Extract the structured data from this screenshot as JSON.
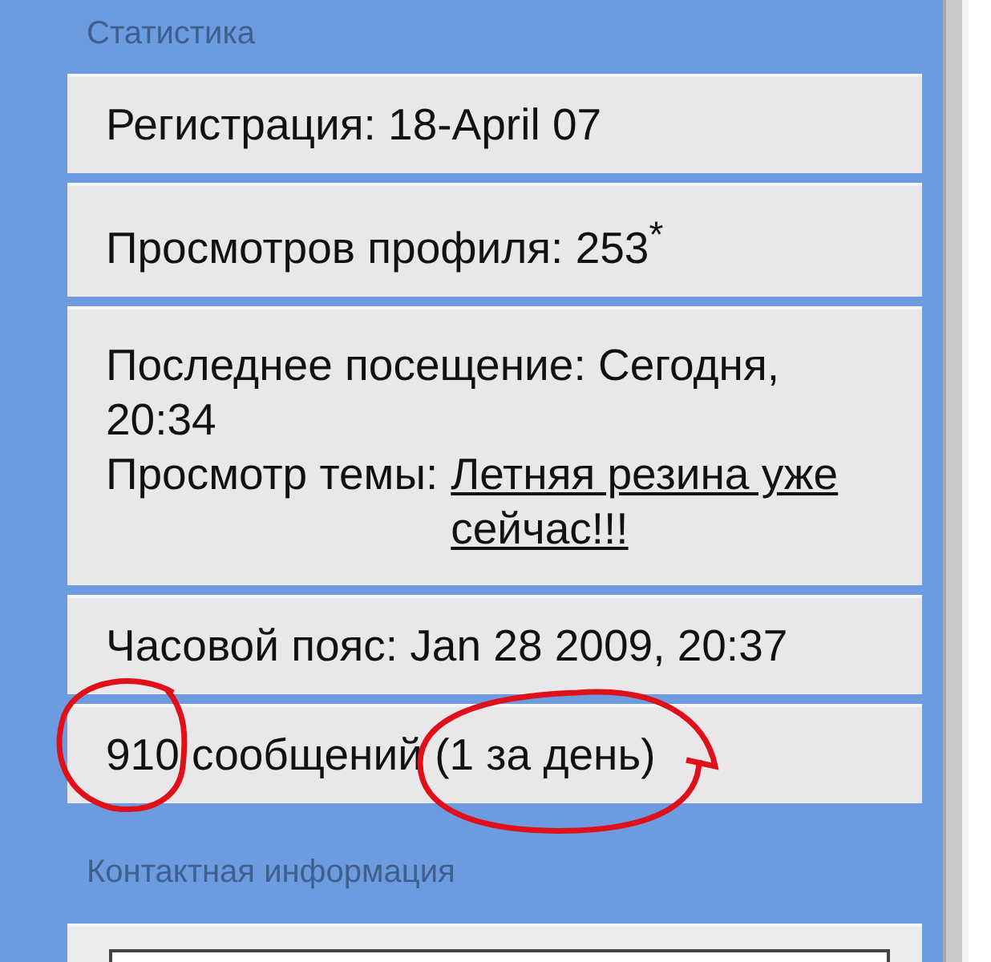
{
  "sections": [
    {
      "title": "Статистика",
      "rows": [
        {
          "kind": "text",
          "text": "Регистрация: 18-April 07"
        },
        {
          "kind": "text",
          "text": "Просмотров профиля: 253$^{*}$"
        },
        {
          "kind": "visit",
          "text": "Последнее посещение: Сегодня, 20:34",
          "topic_label": "Просмотр темы:",
          "topic_link": "Летняя резина уже сейчас!!!"
        },
        {
          "kind": "text",
          "text": "Часовой пояс: Jan 28 2009, 20:37"
        },
        {
          "kind": "text",
          "text": "910 сообщений (1 за день)"
        }
      ]
    },
    {
      "title": "Контактная информация",
      "rows": [
        {
          "kind": "field"
        }
      ]
    }
  ]
}
